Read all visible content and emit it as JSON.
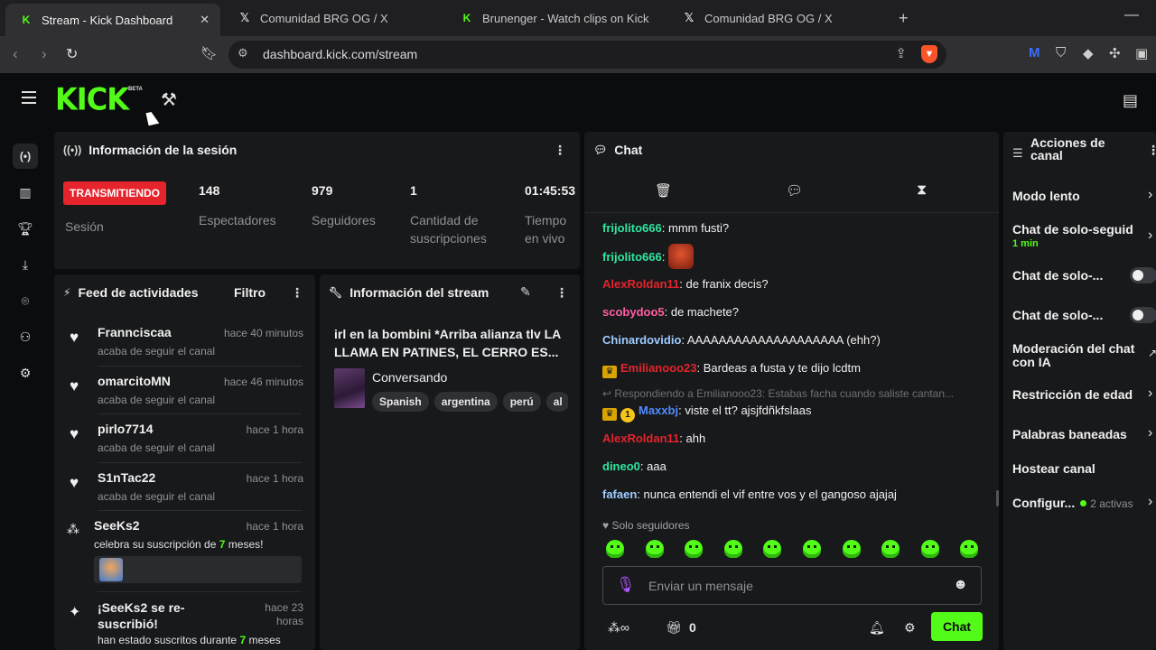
{
  "browser": {
    "tabs": [
      {
        "title": "Stream - Kick Dashboard",
        "favicon": "kick-icon",
        "active": true
      },
      {
        "title": "Comunidad BRG OG / X",
        "favicon": "x-icon",
        "active": false
      },
      {
        "title": "Brunenger - Watch clips on Kick",
        "favicon": "kick-icon",
        "active": false
      },
      {
        "title": "Comunidad BRG OG / X",
        "favicon": "x-icon",
        "active": false
      }
    ],
    "url": "dashboard.kick.com/stream"
  },
  "app": {
    "logo": "KICK",
    "beta": "BETA",
    "accent": "#53fc18",
    "live_color": "#e5242c"
  },
  "session": {
    "title": "Información de la sesión",
    "badge": "TRANSMITIENDO",
    "badge_label": "Sesión",
    "stats": [
      {
        "value": "148",
        "label": "Espectadores"
      },
      {
        "value": "979",
        "label": "Seguidores"
      },
      {
        "value": "1",
        "label_1": "Cantidad de",
        "label_2": "suscripciones"
      },
      {
        "value": "01:45:53",
        "label_1": "Tiempo",
        "label_2": "en vivo"
      }
    ]
  },
  "feed": {
    "title": "Feed de actividades",
    "filter": "Filtro",
    "items": [
      {
        "name": "Frannciscaa",
        "time": "hace 40 minutos",
        "desc": "acaba de seguir el canal"
      },
      {
        "name": "omarcitoMN",
        "time": "hace 46 minutos",
        "desc": "acaba de seguir el canal"
      },
      {
        "name": "pirlo7714",
        "time": "hace 1 hora",
        "desc": "acaba de seguir el canal"
      },
      {
        "name": "S1nTac22",
        "time": "hace 1 hora",
        "desc": "acaba de seguir el canal"
      },
      {
        "name": "SeeKs2",
        "time": "hace 1 hora",
        "desc_pre": "celebra su suscripción de ",
        "desc_hl": "7",
        "desc_post": " meses!"
      },
      {
        "name_1": "¡SeeKs2 se re-",
        "name_2": "suscribió!",
        "time_1": "hace 23",
        "time_2": "horas",
        "desc_pre": "han estado suscritos durante ",
        "desc_hl": "7",
        "desc_post": " meses"
      }
    ]
  },
  "stream_info": {
    "title": "Información del stream",
    "stream_title_1": "irl en la bombini *Arriba alianza tlv LA",
    "stream_title_2": "LLAMA EN PATINES, EL CERRO ES...",
    "category": "Conversando",
    "tags": [
      "Spanish",
      "argentina",
      "perú",
      "al"
    ]
  },
  "chat": {
    "title": "Chat",
    "messages": [
      {
        "user": "frijolito666",
        "color": "#2ee6a0",
        "text": "mmm fusti?"
      },
      {
        "user": "frijolito666",
        "color": "#2ee6a0",
        "text": "",
        "emote": true
      },
      {
        "user": "AlexRoldan11",
        "color": "#e5242c",
        "text": "de franix decis?"
      },
      {
        "user": "scobydoo5",
        "color": "#ff5fa2",
        "text": "de machete?"
      },
      {
        "user": "Chinardovidio",
        "color": "#9ecbff",
        "text": "AAAAAAAAAAAAAAAAAAAA (ehh?)"
      },
      {
        "user": "Emilianooo23",
        "color": "#e5242c",
        "text": "Bardeas a fusta y te dijo lcdtm",
        "badge": "crown"
      },
      {
        "user": "Maxxbj",
        "color": "#4f8bff",
        "text": "viste el tt? ajsjfdñkfslaas",
        "badge": "crown-sub",
        "reply": "Respondiendo a Emilianooo23: Estabas facha cuando saliste cantan..."
      },
      {
        "user": "AlexRoldan11",
        "color": "#e5242c",
        "text": "ahh"
      },
      {
        "user": "dineo0",
        "color": "#2ee6a0",
        "text": "aaa"
      },
      {
        "user": "fafaen",
        "color": "#9ecbff",
        "text": "nunca entendi el vif entre vos y el gangoso ajajaj"
      }
    ],
    "mode": "Solo seguidores",
    "placeholder": "Enviar un mensaje",
    "points": "0",
    "send": "Chat",
    "sub_badge": "1"
  },
  "channel_actions": {
    "title_1": "Acciones de",
    "title_2": "canal",
    "items": [
      {
        "label": "Modo lento",
        "control": "chevron"
      },
      {
        "label": "Chat de solo-seguid",
        "sub": "1 min",
        "control": "chevron"
      },
      {
        "label": "Chat de solo-...",
        "control": "toggle"
      },
      {
        "label": "Chat de solo-...",
        "control": "toggle"
      },
      {
        "label_1": "Moderación del chat",
        "label_2": "con IA",
        "control": "external"
      },
      {
        "label": "Restricción de edad",
        "control": "chevron"
      },
      {
        "label": "Palabras baneadas",
        "control": "chevron"
      },
      {
        "label": "Hostear canal",
        "control": "none"
      },
      {
        "label": "Configur...",
        "status": "2 activas",
        "control": "chevron"
      }
    ]
  }
}
